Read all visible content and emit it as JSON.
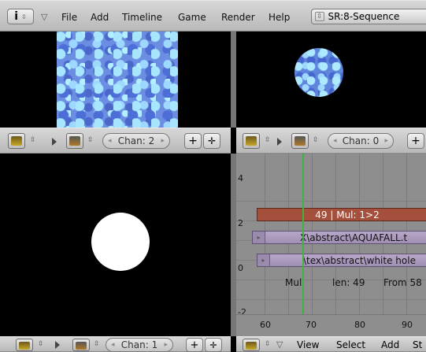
{
  "menu": {
    "items": [
      "File",
      "Add",
      "Timeline",
      "Game",
      "Render",
      "Help"
    ],
    "scene_select": "SR:8-Sequence"
  },
  "preview_left": {
    "channel_label": "Chan: 2"
  },
  "preview_right": {
    "channel_label": "Chan: 0"
  },
  "preview_bottom": {
    "channel_label": "Chan: 1"
  },
  "sequencer": {
    "y_ticks": [
      "4",
      "2",
      "0",
      "-2"
    ],
    "x_ticks": [
      "60",
      "70",
      "80",
      "90"
    ],
    "strips": {
      "effect": "49 | Mul: 1>2",
      "movie": "X\\abstract\\AQUAFALL.t",
      "image": "\\tex\\abstract\\white hole"
    },
    "status": {
      "name": "Mul",
      "len": "len: 49",
      "from": "From 58"
    },
    "menu": [
      "View",
      "Select",
      "Add",
      "St"
    ]
  },
  "colors": {
    "effect_strip": "#a4503c",
    "cursor_line": "#3fb33f",
    "header_bg": "#c8c8c8"
  },
  "icons": [
    "info-icon",
    "window-type-icon",
    "image-preview-icon",
    "render-icon",
    "view-center-icon",
    "channel-arrows-icon"
  ]
}
